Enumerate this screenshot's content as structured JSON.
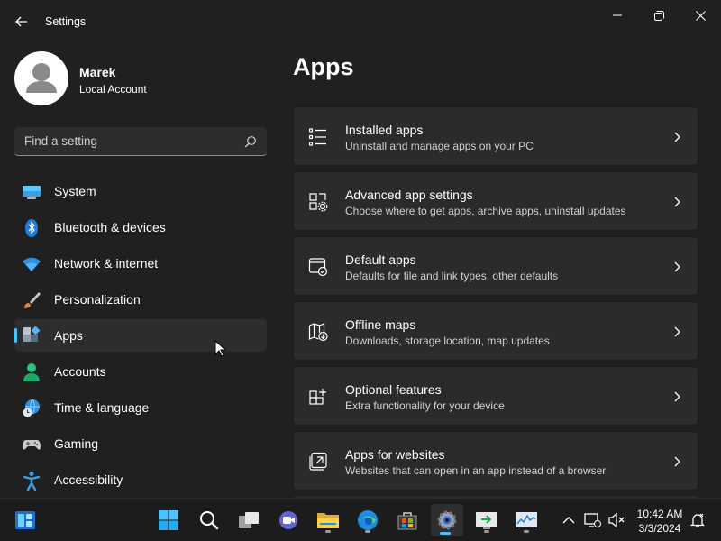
{
  "window": {
    "title": "Settings",
    "back_icon": "arrow-left-icon",
    "controls": [
      "minimize-icon",
      "restore-icon",
      "close-icon"
    ]
  },
  "profile": {
    "name": "Marek",
    "account_type": "Local Account"
  },
  "search": {
    "placeholder": "Find a setting"
  },
  "sidebar": {
    "active": "Apps",
    "items": [
      {
        "label": "System",
        "icon": "monitor-icon"
      },
      {
        "label": "Bluetooth & devices",
        "icon": "bluetooth-icon"
      },
      {
        "label": "Network & internet",
        "icon": "wifi-icon"
      },
      {
        "label": "Personalization",
        "icon": "brush-icon"
      },
      {
        "label": "Apps",
        "icon": "apps-icon"
      },
      {
        "label": "Accounts",
        "icon": "person-icon"
      },
      {
        "label": "Time & language",
        "icon": "globe-clock-icon"
      },
      {
        "label": "Gaming",
        "icon": "controller-icon"
      },
      {
        "label": "Accessibility",
        "icon": "accessibility-icon"
      }
    ]
  },
  "main": {
    "title": "Apps",
    "cards": [
      {
        "title": "Installed apps",
        "description": "Uninstall and manage apps on your PC",
        "icon": "list-icon"
      },
      {
        "title": "Advanced app settings",
        "description": "Choose where to get apps, archive apps, uninstall updates",
        "icon": "app-settings-icon"
      },
      {
        "title": "Default apps",
        "description": "Defaults for file and link types, other defaults",
        "icon": "default-apps-icon"
      },
      {
        "title": "Offline maps",
        "description": "Downloads, storage location, map updates",
        "icon": "map-download-icon"
      },
      {
        "title": "Optional features",
        "description": "Extra functionality for your device",
        "icon": "add-features-icon"
      },
      {
        "title": "Apps for websites",
        "description": "Websites that can open in an app instead of a browser",
        "icon": "open-in-app-icon"
      }
    ]
  },
  "taskbar": {
    "time": "10:42 AM",
    "date": "3/3/2024",
    "apps": [
      "widgets-icon",
      "start-icon",
      "search-icon",
      "task-view-icon",
      "teams-icon",
      "file-explorer-icon",
      "edge-icon",
      "store-icon",
      "settings-icon",
      "remote-desktop-icon",
      "task-manager-icon"
    ],
    "tray": [
      "chevron-up-icon",
      "network-icon",
      "volume-muted-icon",
      "notification-icon"
    ]
  },
  "colors": {
    "accent": "#4cc2ff",
    "background": "#202020",
    "card": "#2b2b2b"
  }
}
